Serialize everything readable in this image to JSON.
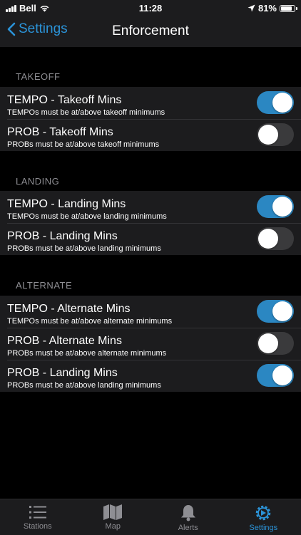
{
  "status": {
    "carrier": "Bell",
    "time": "11:28",
    "battery": "81%"
  },
  "nav": {
    "back_label": "Settings",
    "title": "Enforcement"
  },
  "sections": [
    {
      "header": "TAKEOFF",
      "rows": [
        {
          "title": "TEMPO - Takeoff Mins",
          "subtitle": "TEMPOs must be at/above takeoff minimums",
          "on": true
        },
        {
          "title": "PROB - Takeoff Mins",
          "subtitle": "PROBs must be at/above takeoff minimums",
          "on": false
        }
      ]
    },
    {
      "header": "LANDING",
      "rows": [
        {
          "title": "TEMPO - Landing Mins",
          "subtitle": "TEMPOs must be at/above landing minimums",
          "on": true
        },
        {
          "title": "PROB - Landing Mins",
          "subtitle": "PROBs must be at/above landing minimums",
          "on": false
        }
      ]
    },
    {
      "header": "ALTERNATE",
      "rows": [
        {
          "title": "TEMPO - Alternate Mins",
          "subtitle": "TEMPOs must be at/above alternate minimums",
          "on": true
        },
        {
          "title": "PROB - Alternate Mins",
          "subtitle": "PROBs must be at/above alternate minimums",
          "on": false
        },
        {
          "title": "PROB - Landing Mins",
          "subtitle": "PROBs must be at/above landing minimums",
          "on": true
        }
      ]
    }
  ],
  "tabs": [
    {
      "label": "Stations",
      "icon": "list-icon",
      "active": false
    },
    {
      "label": "Map",
      "icon": "map-icon",
      "active": false
    },
    {
      "label": "Alerts",
      "icon": "bell-icon",
      "active": false
    },
    {
      "label": "Settings",
      "icon": "gear-icon",
      "active": true
    }
  ],
  "colors": {
    "accent": "#2b93d8",
    "toggle_on": "#2b87c2",
    "toggle_off": "#3a3a3c",
    "cell_bg": "#1c1c1e"
  }
}
